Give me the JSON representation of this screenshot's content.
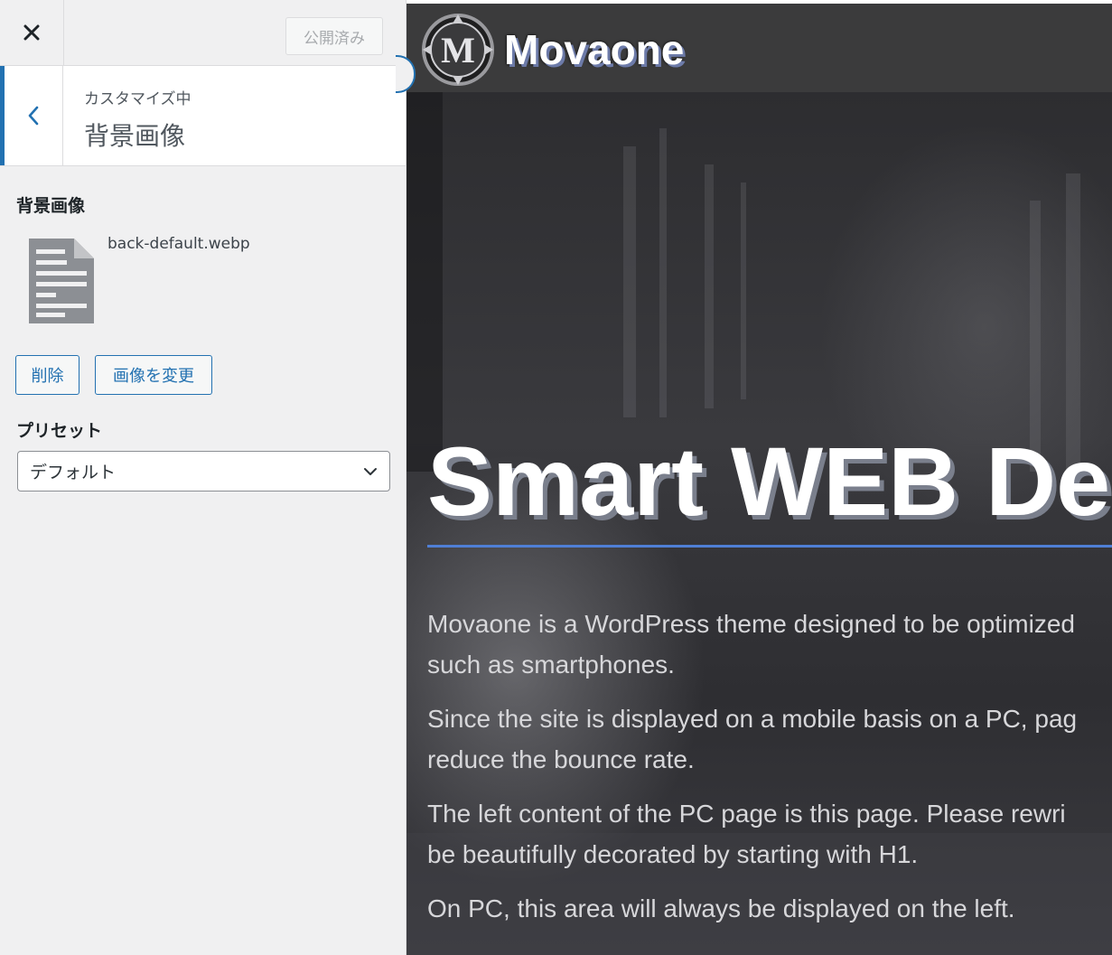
{
  "topbar": {
    "close_label": "✕",
    "publish_label": "公開済み"
  },
  "section": {
    "breadcrumb": "カスタマイズ中",
    "title": "背景画像"
  },
  "background_image": {
    "label": "背景画像",
    "filename": "back-default.webp",
    "remove_label": "削除",
    "change_label": "画像を変更"
  },
  "preset": {
    "label": "プリセット",
    "selected": "デフォルト"
  },
  "preview": {
    "site_title": "Movaone",
    "logo_letter": "M",
    "heading": "Smart WEB De",
    "paragraphs": [
      "Movaone is a WordPress theme designed to be optimized",
      "such as smartphones.",
      "Since the site is displayed on a mobile basis on a PC, pag",
      "reduce the bounce rate.",
      "The left content of the PC page is this page. Please rewri",
      "be beautifully decorated by starting with H1.",
      "On PC, this area will always be displayed on the left."
    ]
  },
  "colors": {
    "accent": "#2271b1",
    "heading_rule": "#4f7fd6",
    "header_bg": "#3b3b3c"
  }
}
